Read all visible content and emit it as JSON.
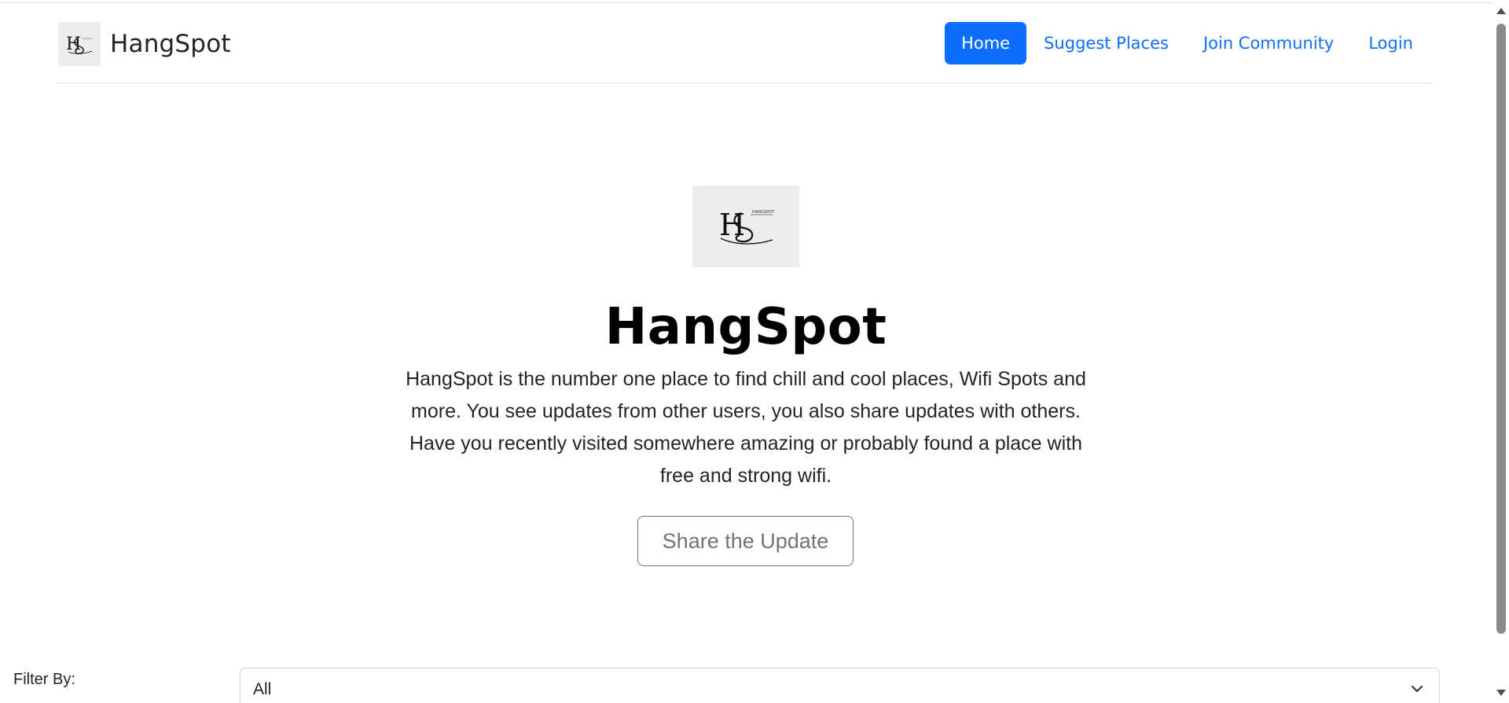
{
  "navbar": {
    "brand_name": "HangSpot",
    "brand_logo_icon": "hangspot-logo-icon",
    "links": [
      {
        "label": "Home",
        "active": true
      },
      {
        "label": "Suggest Places",
        "active": false
      },
      {
        "label": "Join Community",
        "active": false
      },
      {
        "label": "Login",
        "active": false
      }
    ]
  },
  "hero": {
    "logo_icon": "hangspot-logo-icon",
    "title": "HangSpot",
    "lead": "HangSpot is the number one place to find chill and cool places, Wifi Spots and more. You see updates from other users, you also share updates with others. Have you recently visited somewhere amazing or probably found a place with free and strong wifi.",
    "cta_label": "Share the Update"
  },
  "filter": {
    "label": "Filter By:",
    "selected": "All",
    "chevron_icon": "chevron-down-icon"
  },
  "colors": {
    "primary": "#0d6efd",
    "secondary": "#6c757d",
    "border": "#dee2e6",
    "logo_bg": "#ededed"
  }
}
